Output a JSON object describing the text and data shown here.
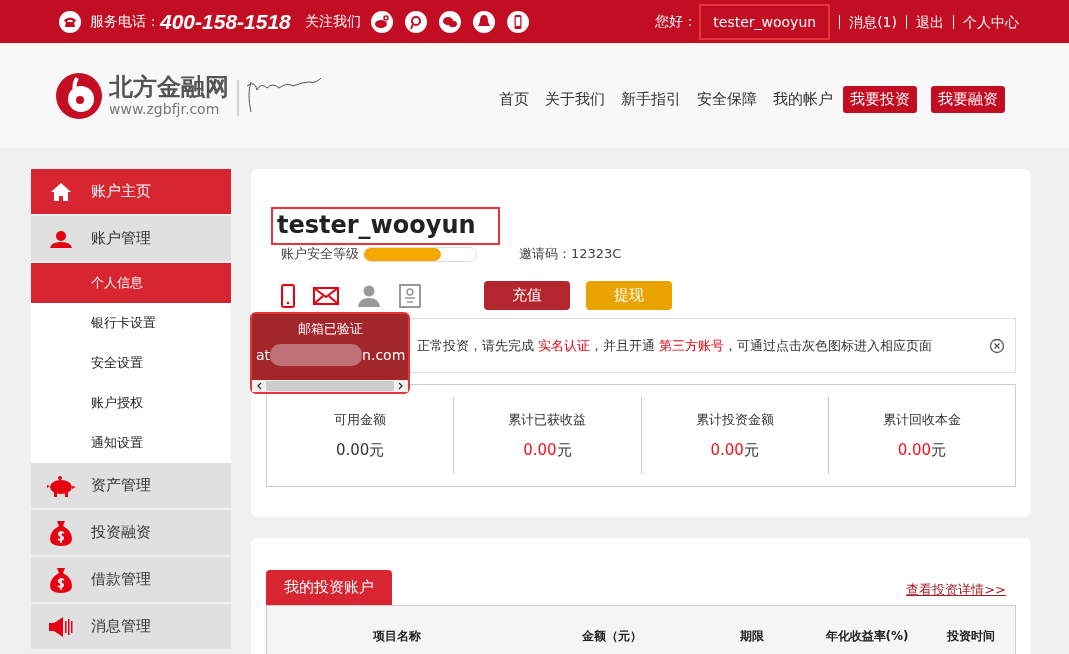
{
  "top_bar": {
    "hotline_label": "服务电话：",
    "hotline": "400-158-1518",
    "follow_label": "关注我们",
    "social_icons": [
      {
        "kind": "weibo"
      },
      {
        "kind": "tencent-weibo"
      },
      {
        "kind": "wechat"
      },
      {
        "kind": "qq"
      },
      {
        "kind": "mobile"
      }
    ],
    "greeting": "您好：",
    "username": "tester_wooyun",
    "username_highlighted": true,
    "links": [
      "消息(1)",
      "退出",
      "个人中心"
    ]
  },
  "header": {
    "logo_name": "北方金融网",
    "logo_url": "www.zgbfjr.com",
    "nav": [
      {
        "label": "首页",
        "kind": "plain"
      },
      {
        "label": "关于我们",
        "kind": "plain"
      },
      {
        "label": "新手指引",
        "kind": "plain"
      },
      {
        "label": "安全保障",
        "kind": "plain"
      },
      {
        "label": "我的帐户",
        "kind": "plain"
      },
      {
        "label": "我要投资",
        "kind": "button"
      },
      {
        "label": "我要融资",
        "kind": "button"
      }
    ]
  },
  "sidebar": {
    "items": [
      {
        "label": "账户主页",
        "kind": "home",
        "selected": true
      },
      {
        "label": "账户管理",
        "kind": "person",
        "selected": false,
        "children": [
          {
            "label": "个人信息",
            "selected": true
          },
          {
            "label": "银行卡设置",
            "selected": false
          },
          {
            "label": "安全设置",
            "selected": false
          },
          {
            "label": "账户授权",
            "selected": false
          },
          {
            "label": "通知设置",
            "selected": false
          }
        ]
      },
      {
        "label": "资产管理",
        "kind": "piggy",
        "selected": false
      },
      {
        "label": "投资融资",
        "kind": "moneybag",
        "selected": false
      },
      {
        "label": "借款管理",
        "kind": "moneybag",
        "selected": false
      },
      {
        "label": "消息管理",
        "kind": "speaker",
        "selected": false
      }
    ]
  },
  "profile": {
    "username": "tester_wooyun",
    "username_highlighted": true,
    "security_label": "账户安全等级",
    "security": {
      "level": 0.69
    },
    "invite": "邀请码：12323C",
    "verify_icons": [
      {
        "kind": "phone",
        "verified": true
      },
      {
        "kind": "email",
        "verified": true
      },
      {
        "kind": "person",
        "verified": false
      },
      {
        "kind": "card",
        "verified": false
      }
    ],
    "buttons": [
      {
        "label": "充值",
        "kind": "recharge"
      },
      {
        "label": "提现",
        "kind": "withdraw"
      }
    ],
    "popup": {
      "title": "邮箱已验证",
      "email_start": "at",
      "email_end": "n.com",
      "highlighted": true
    },
    "notice": [
      {
        "text": "正常投资，请先完成 ",
        "kind": "plain"
      },
      {
        "text": "实名认证",
        "kind": "link"
      },
      {
        "text": "，并且开通 ",
        "kind": "plain"
      },
      {
        "text": "第三方账号",
        "kind": "link"
      },
      {
        "text": "，可通过点击灰色图标进入相应页面",
        "kind": "plain"
      }
    ],
    "stats": [
      {
        "label": "可用金额",
        "amount": "0.00",
        "unit": "元",
        "highlight": false
      },
      {
        "label": "累计已获收益",
        "amount": "0.00",
        "unit": "元",
        "highlight": true
      },
      {
        "label": "累计投资金额",
        "amount": "0.00",
        "unit": "元",
        "highlight": true
      },
      {
        "label": "累计回收本金",
        "amount": "0.00",
        "unit": "元",
        "highlight": true
      }
    ]
  },
  "investments": {
    "tab": "我的投资账户",
    "details_link": "查看投资详情>>",
    "columns": [
      "项目名称",
      "金额（元）",
      "期限",
      "年化收益率(%)",
      "投资时间"
    ]
  }
}
